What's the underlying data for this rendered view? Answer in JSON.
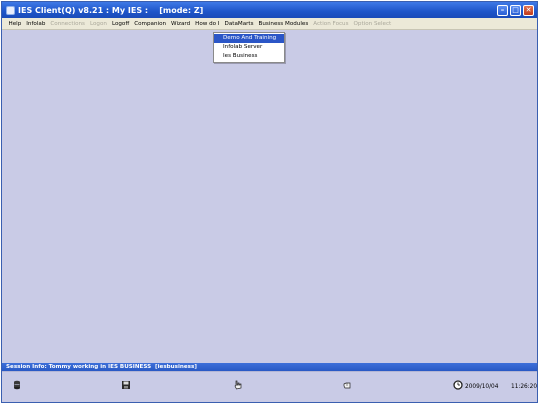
{
  "window": {
    "title": "IES Client(Q) v8.21 : My IES :    [mode: Z]"
  },
  "menu": [
    {
      "label": "Help",
      "enabled": true
    },
    {
      "label": "Infolab",
      "enabled": true
    },
    {
      "label": "Connections",
      "enabled": false
    },
    {
      "label": "Logon",
      "enabled": false
    },
    {
      "label": "Logoff",
      "enabled": true
    },
    {
      "label": "Companion",
      "enabled": true
    },
    {
      "label": "Wizard",
      "enabled": true
    },
    {
      "label": "How do I",
      "enabled": true
    },
    {
      "label": "DataMarts",
      "enabled": true
    },
    {
      "label": "Business Modules",
      "enabled": true
    },
    {
      "label": "Action Focus",
      "enabled": false
    },
    {
      "label": "Option Select",
      "enabled": false
    }
  ],
  "datamarts_dropdown": {
    "items": [
      "Demo And Training",
      "Infolab Server",
      "Ies Business"
    ],
    "selected_index": 0
  },
  "session": {
    "info": "Session Info: Tommy working in IES BUSINESS  [iesbusiness]"
  },
  "status": {
    "icons": [
      "database-icon",
      "save-icon",
      "hand-pointer-icon",
      "hand-icon",
      "clock-icon"
    ],
    "date": "2009/10/04",
    "time": "11:26:20"
  },
  "colors": {
    "title_bar": "#1e55c9",
    "workspace": "#c9cbe6",
    "menu_bar": "#ece9d8",
    "selection": "#2b56c7",
    "session_bar": "#2656c2"
  }
}
